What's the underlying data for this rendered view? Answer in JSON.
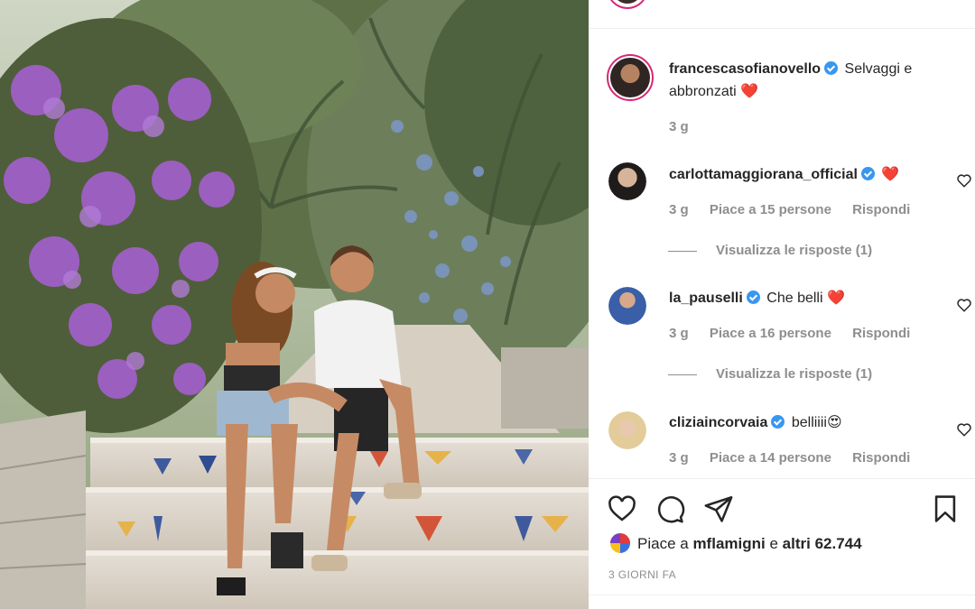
{
  "post": {
    "author": {
      "username": "francescasofianovello",
      "verified": true,
      "caption": "Selvaggi e abbronzati",
      "caption_emoji": "❤️",
      "time": "3 g"
    },
    "comments": [
      {
        "username": "carlottamaggiorana_official",
        "verified": true,
        "text": "",
        "emoji": "❤️",
        "time": "3 g",
        "likes": "Piace a 15 persone",
        "reply_label": "Rispondi",
        "view_replies": "Visualizza le risposte (1)"
      },
      {
        "username": "la_pauselli",
        "verified": true,
        "text": "Che belli",
        "emoji": "❤️",
        "time": "3 g",
        "likes": "Piace a 16 persone",
        "reply_label": "Rispondi",
        "view_replies": "Visualizza le risposte (1)"
      },
      {
        "username": "cliziaincorvaia",
        "verified": true,
        "text": "belliiii",
        "emoji": "😍",
        "time": "3 g",
        "likes": "Piace a 14 persone",
        "reply_label": "Rispondi"
      }
    ],
    "likes_prefix": "Piace a",
    "likes_user": "mflamigni",
    "likes_connector": "e",
    "likes_others": "altri 62.744",
    "posted_ago": "3 GIORNI FA"
  },
  "icons": {
    "like": "heart-icon",
    "comment": "comment-icon",
    "share": "paper-plane-icon",
    "save": "bookmark-icon",
    "comment_like": "small-heart-icon",
    "verified": "verified-badge-icon"
  },
  "colors": {
    "verified": "#3897f0",
    "story_ring": "#d62976",
    "meta_text": "#8e8e8e",
    "heart": "#ed1c24"
  }
}
